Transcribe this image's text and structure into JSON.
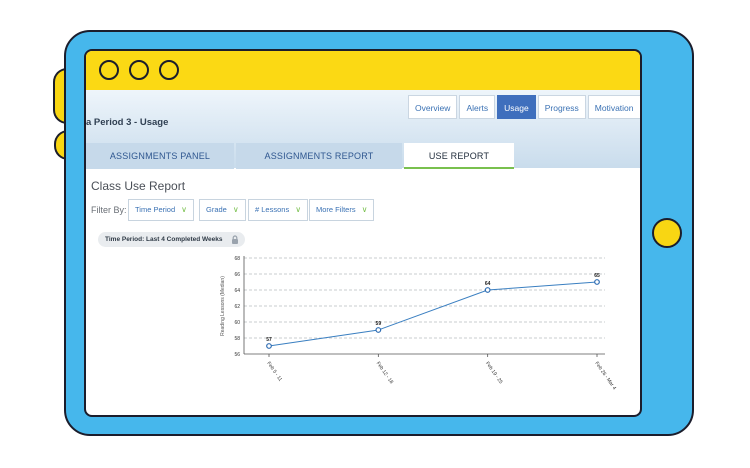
{
  "app": {
    "page_title": "a Period 3 - Usage"
  },
  "top_tabs": [
    {
      "label": "Overview",
      "active": false
    },
    {
      "label": "Alerts",
      "active": false
    },
    {
      "label": "Usage",
      "active": true
    },
    {
      "label": "Progress",
      "active": false
    },
    {
      "label": "Motivation",
      "active": false
    }
  ],
  "panel_tabs": [
    {
      "label": "ASSIGNMENTS PANEL",
      "active": false
    },
    {
      "label": "ASSIGNMENTS REPORT",
      "active": false
    },
    {
      "label": "USE REPORT",
      "active": true
    }
  ],
  "report": {
    "title": "Class Use Report",
    "filter_label": "Filter By:",
    "filters": [
      "Time Period",
      "Grade",
      "# Lessons",
      "More Filters"
    ],
    "time_period_pill": "Time Period: Last 4 Completed Weeks"
  },
  "icons": {
    "window_dots": "circle-outline",
    "filter_chevron": "chevron-down-icon",
    "pill_lock": "lock-icon"
  },
  "colors": {
    "tablet": "#46b7ec",
    "titlebar": "#fbd914",
    "accent_blue": "#3f6fbd",
    "accent_green": "#79c04e",
    "line": "#3a7fc1"
  },
  "chart_data": {
    "type": "line",
    "ylabel": "Reading Lessons (Median)",
    "categories": [
      "Feb 5 - 11",
      "Feb 12 - 18",
      "Feb 19 - 25",
      "Feb 26 - Mar 4"
    ],
    "values": [
      57,
      59,
      64,
      65
    ],
    "data_labels": [
      "57",
      "59",
      "64",
      "65"
    ],
    "yticks": [
      56,
      58,
      60,
      62,
      64,
      66,
      68
    ],
    "ylim": [
      56,
      68
    ],
    "grid": true
  }
}
